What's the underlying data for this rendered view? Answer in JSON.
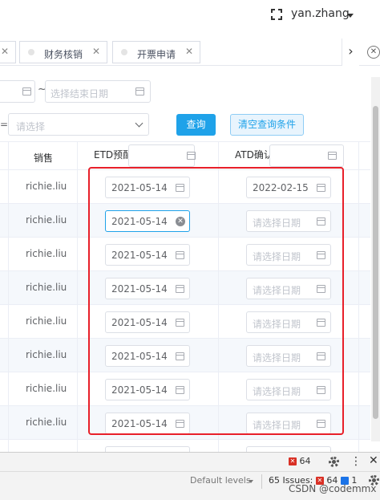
{
  "header": {
    "username": "yan.zhang"
  },
  "tabs": [
    {
      "label": "财务核销"
    },
    {
      "label": "开票申请"
    }
  ],
  "filters": {
    "end_date_placeholder": "选择结束日期",
    "range_separator": "~",
    "select_placeholder": "请选择",
    "query_label": "查询",
    "clear_label": "清空查询条件"
  },
  "table": {
    "columns": {
      "sales": "销售",
      "etd": "ETD预配",
      "atd": "ATD确认"
    },
    "rows": [
      {
        "sales": "richie.liu",
        "etd": "2021-05-14",
        "atd": "2022-02-15"
      },
      {
        "sales": "richie.liu",
        "etd": "2021-05-14",
        "atd": "请选择日期"
      },
      {
        "sales": "richie.liu",
        "etd": "2021-05-14",
        "atd": "请选择日期"
      },
      {
        "sales": "richie.liu",
        "etd": "2021-05-14",
        "atd": "请选择日期"
      },
      {
        "sales": "richie.liu",
        "etd": "2021-05-14",
        "atd": "请选择日期"
      },
      {
        "sales": "richie.liu",
        "etd": "2021-05-14",
        "atd": "请选择日期"
      },
      {
        "sales": "richie.liu",
        "etd": "2021-05-14",
        "atd": "请选择日期"
      },
      {
        "sales": "richie.liu",
        "etd": "2021-05-14",
        "atd": "请选择日期"
      }
    ]
  },
  "devtools": {
    "error_count": "64",
    "default_levels": "Default levels",
    "issues_label": "65 Issues:",
    "issues_errors": "64",
    "issues_messages": "1"
  },
  "watermark": "CSDN @codemmx",
  "colors": {
    "primary": "#1fa2e9",
    "highlight_border": "#e8202a",
    "stripe": "#f5f8fc"
  }
}
